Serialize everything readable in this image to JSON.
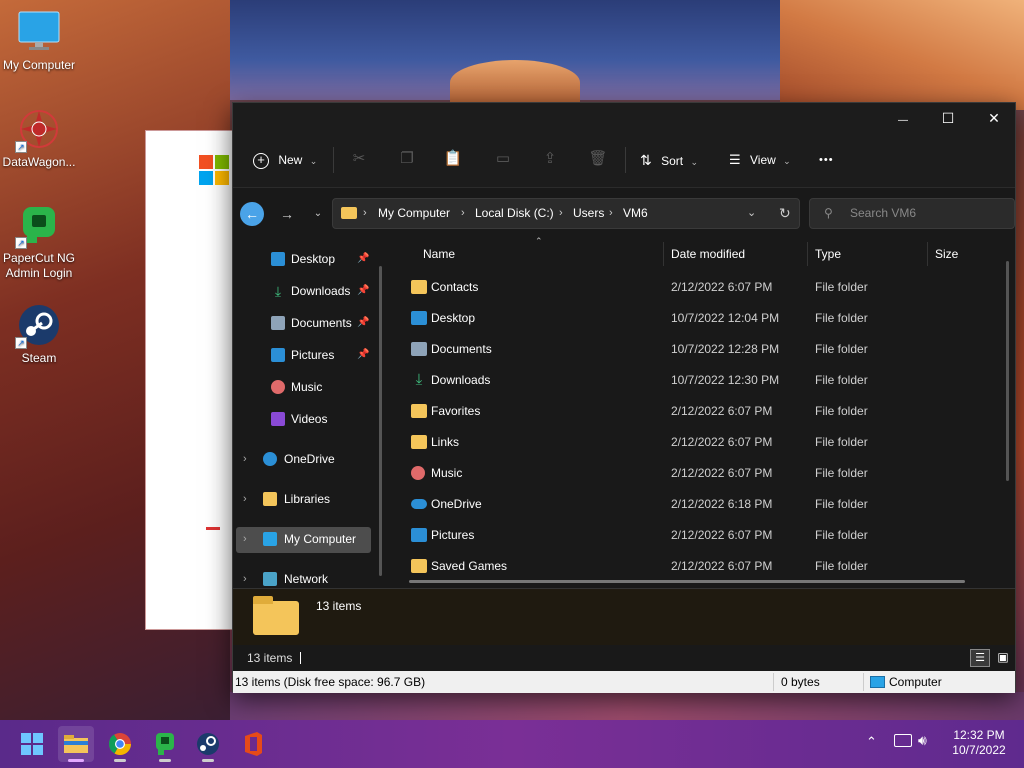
{
  "desktop": {
    "icons": [
      {
        "label": "My Computer",
        "icon": "monitor-icon"
      },
      {
        "label": "DataWagon...",
        "icon": "datawagon-icon"
      },
      {
        "label": "PaperCut NG Admin Login",
        "icon": "papercut-icon"
      },
      {
        "label": "Steam",
        "icon": "steam-icon"
      }
    ]
  },
  "explorer": {
    "window_controls": {
      "minimize": "—",
      "maximize": "☐",
      "close": "✕"
    },
    "toolbar": {
      "new_label": "New",
      "sort_label": "Sort",
      "view_label": "View",
      "more_label": "•••"
    },
    "address": {
      "crumbs": [
        "My Computer",
        "Local Disk (C:)",
        "Users",
        "VM6"
      ],
      "search_placeholder": "Search VM6"
    },
    "nav": {
      "quick_access": [
        {
          "label": "Desktop",
          "pinned": true,
          "icon": "desktop-icon"
        },
        {
          "label": "Downloads",
          "pinned": true,
          "icon": "download-icon"
        },
        {
          "label": "Documents",
          "pinned": true,
          "icon": "document-icon"
        },
        {
          "label": "Pictures",
          "pinned": true,
          "icon": "picture-icon"
        },
        {
          "label": "Music",
          "pinned": false,
          "icon": "music-icon"
        },
        {
          "label": "Videos",
          "pinned": false,
          "icon": "video-icon"
        }
      ],
      "groups": [
        {
          "label": "OneDrive",
          "icon": "cloud-icon"
        },
        {
          "label": "Libraries",
          "icon": "folder-icon"
        },
        {
          "label": "My Computer",
          "icon": "monitor-icon",
          "selected": true
        },
        {
          "label": "Network",
          "icon": "network-icon"
        }
      ]
    },
    "columns": {
      "name": "Name",
      "date": "Date modified",
      "type": "Type",
      "size": "Size"
    },
    "files": [
      {
        "name": "Contacts",
        "date": "2/12/2022 6:07 PM",
        "type": "File folder",
        "icon": "folder-icon"
      },
      {
        "name": "Desktop",
        "date": "10/7/2022 12:04 PM",
        "type": "File folder",
        "icon": "desktop-icon"
      },
      {
        "name": "Documents",
        "date": "10/7/2022 12:28 PM",
        "type": "File folder",
        "icon": "document-icon"
      },
      {
        "name": "Downloads",
        "date": "10/7/2022 12:30 PM",
        "type": "File folder",
        "icon": "download-icon"
      },
      {
        "name": "Favorites",
        "date": "2/12/2022 6:07 PM",
        "type": "File folder",
        "icon": "folder-icon"
      },
      {
        "name": "Links",
        "date": "2/12/2022 6:07 PM",
        "type": "File folder",
        "icon": "folder-icon"
      },
      {
        "name": "Music",
        "date": "2/12/2022 6:07 PM",
        "type": "File folder",
        "icon": "music-icon"
      },
      {
        "name": "OneDrive",
        "date": "2/12/2022 6:18 PM",
        "type": "File folder",
        "icon": "cloud-icon"
      },
      {
        "name": "Pictures",
        "date": "2/12/2022 6:07 PM",
        "type": "File folder",
        "icon": "picture-icon"
      },
      {
        "name": "Saved Games",
        "date": "2/12/2022 6:07 PM",
        "type": "File folder",
        "icon": "folder-icon"
      }
    ],
    "details_pane": {
      "summary": "13 items"
    },
    "status": {
      "item_count": "13 items"
    },
    "bottom_bar": {
      "disk_info": "13 items (Disk free space: 96.7 GB)",
      "size": "0 bytes",
      "location": "Computer"
    }
  },
  "taskbar": {
    "apps": [
      "start-icon",
      "file-explorer-icon",
      "chrome-icon",
      "papercut-icon",
      "steam-icon",
      "office-icon"
    ],
    "clock": {
      "time": "12:32 PM",
      "date": "10/7/2022"
    }
  },
  "colors": {
    "folder": "#f4c55a",
    "accent": "#1a78d6",
    "taskbar": "#6b2b8f"
  }
}
